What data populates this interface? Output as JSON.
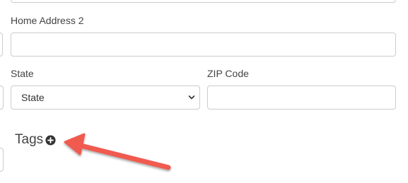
{
  "form": {
    "home_address_2": {
      "label": "Home Address 2",
      "value": ""
    },
    "state": {
      "label": "State",
      "selected": "State"
    },
    "zip": {
      "label": "ZIP Code",
      "value": ""
    }
  },
  "tags": {
    "title": "Tags",
    "add_icon": "plus-circle-icon"
  },
  "annotation": {
    "type": "arrow",
    "color": "#f05a4f"
  }
}
